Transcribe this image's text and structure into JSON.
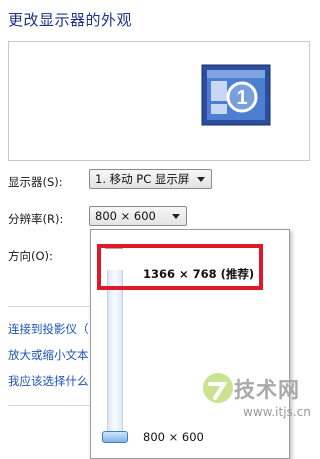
{
  "header": {
    "title": "更改显示器的外观"
  },
  "preview": {
    "monitor_number": "1"
  },
  "display": {
    "label": "显示器(S):",
    "value": "1. 移动 PC 显示屏"
  },
  "resolution": {
    "label": "分辨率(R):",
    "value": "800 × 600",
    "options": {
      "highest": "1366 × 768 (推荐)",
      "lowest": "800 × 600"
    },
    "level": 0
  },
  "orientation": {
    "label": "方向(O):"
  },
  "links": [
    {
      "label": "连接到投影仪（"
    },
    {
      "label": "放大或缩小文本"
    },
    {
      "label": "我应该选择什么"
    }
  ],
  "watermark": {
    "brand": "技术网",
    "url": "www.itjs.cn"
  },
  "colors": {
    "highlight_box": "#e0182a",
    "link": "#1f54b5",
    "title": "#1e3287"
  },
  "icons": [
    "monitor-icon",
    "dropdown-arrow-icon",
    "slider-thumb-icon",
    "watermark-logo-icon"
  ]
}
